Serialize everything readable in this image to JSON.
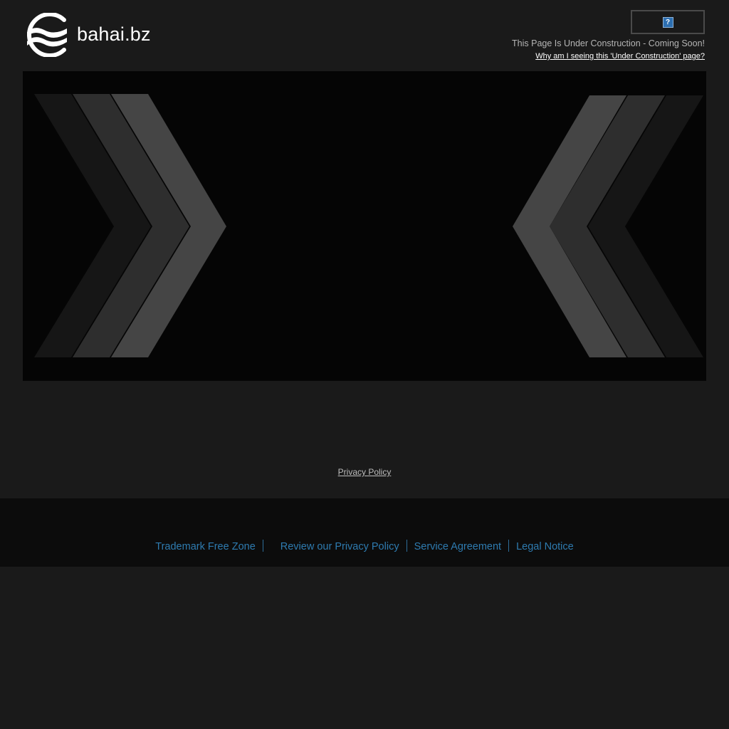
{
  "header": {
    "site_name": "bahai.bz",
    "logo_icon": "waves-logo-icon",
    "help_icon": "question-mark-icon",
    "help_glyph": "?",
    "notice": "This Page Is Under Construction - Coming Soon!",
    "why_link": "Why am I seeing this 'Under Construction' page?"
  },
  "banner": {
    "left_icon": "chevrons-right-icon",
    "right_icon": "chevrons-left-icon"
  },
  "main": {
    "privacy_link": "Privacy Policy"
  },
  "footer": {
    "links": [
      "Trademark Free Zone",
      "Review our Privacy Policy",
      "Service Agreement",
      "Legal Notice"
    ],
    "link_color": "#2e7bb0"
  },
  "colors": {
    "background": "#1a1a1a",
    "banner": "#050505",
    "footer": "#0c0c0c"
  }
}
